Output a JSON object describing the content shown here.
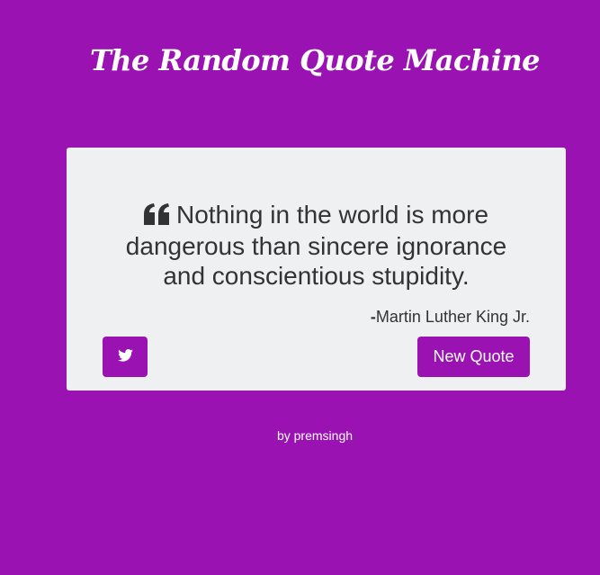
{
  "header": {
    "title": "The Random Quote Machine"
  },
  "quote": {
    "text": "Nothing in the world is more dangerous than sincere ignorance and conscientious stupidity.",
    "dash": "-",
    "author": "Martin Luther King Jr.",
    "icon": "quote-left-icon"
  },
  "actions": {
    "tweet_icon": "twitter-icon",
    "new_quote_label": "New Quote"
  },
  "footer": {
    "credit": "by premsingh"
  },
  "colors": {
    "background": "#9b12b2",
    "card": "#eef0f1",
    "text": "#333333",
    "button": "#9b12b2"
  }
}
